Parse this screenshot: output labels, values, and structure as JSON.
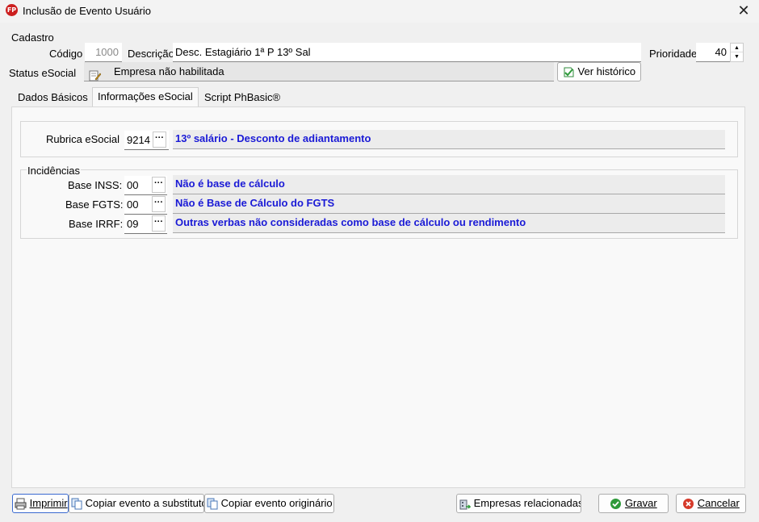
{
  "window": {
    "title": "Inclusão de Evento Usuário",
    "icon_text": "FP"
  },
  "cadastro": {
    "label": "Cadastro",
    "codigo_label": "Código",
    "codigo_value": "1000",
    "descricao_label": "Descrição",
    "descricao_value": "Desc. Estagiário 1ª P 13º Sal",
    "prioridade_label": "Prioridade",
    "prioridade_value": "40",
    "status_label": "Status eSocial",
    "status_value": "Empresa não habilitada",
    "historico_button": "Ver histórico"
  },
  "tabs": [
    {
      "label": "Dados Básicos"
    },
    {
      "label": "Informações eSocial"
    },
    {
      "label": "Script PhBasic®"
    }
  ],
  "esocial": {
    "rubrica_label": "Rubrica eSocial",
    "rubrica_code": "9214",
    "rubrica_desc": "13º salário - Desconto de adiantamento",
    "incidencias_label": "Incidências",
    "rows": [
      {
        "label": "Base INSS:",
        "code": "00",
        "desc": "Não é base de cálculo"
      },
      {
        "label": "Base FGTS:",
        "code": "00",
        "desc": "Não é Base de Cálculo do FGTS"
      },
      {
        "label": "Base IRRF:",
        "code": "09",
        "desc": "Outras verbas não consideradas como base de cálculo ou rendimento"
      }
    ]
  },
  "footer": {
    "imprimir": "Imprimir",
    "copiar_substituto": "Copiar evento a substituto",
    "copiar_originario": "Copiar evento originário",
    "empresas": "Empresas relacionadas",
    "gravar": "Gravar",
    "cancelar": "Cancelar"
  },
  "colors": {
    "desc_text": "#1a1ad6",
    "accent_green": "#2e9a3a",
    "cancel_red": "#d63a2a"
  }
}
